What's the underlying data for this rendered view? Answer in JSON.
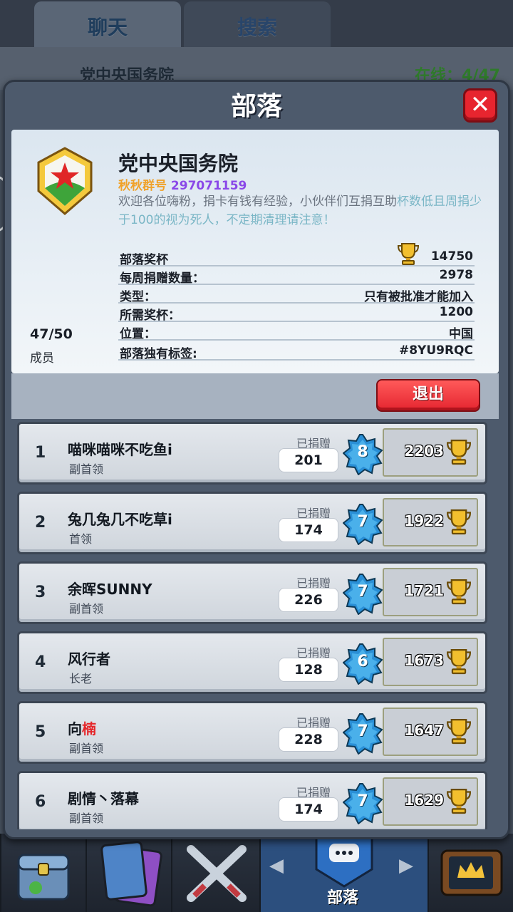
{
  "background": {
    "tabs": [
      {
        "label": "聊天"
      },
      {
        "label": "搜索"
      }
    ],
    "clan_name": "党中央国务院",
    "online": "在线：4/47",
    "bottom_nav_label": "部落"
  },
  "modal": {
    "title": "部落",
    "close": "✕"
  },
  "clan": {
    "name": "党中央国务院",
    "qq_label": "秋秋群号",
    "qq_number": "297071159",
    "desc_part1": "欢迎各位嗨粉，捐卡有钱有经验，小伙伴们互捐互助",
    "desc_part2": "杯数低且周捐少于",
    "desc_num": "100",
    "desc_part3": "的视为死人，不定期清理请注意！",
    "members_count": "47/50",
    "members_label": "成员",
    "stats": [
      {
        "label": "部落奖杯",
        "value": "14750"
      },
      {
        "label": "每周捐赠数量：",
        "value": "2978"
      },
      {
        "label": "类型：",
        "value": "只有被批准才能加入"
      },
      {
        "label": "所需奖杯：",
        "value": "1200"
      },
      {
        "label": "位置：",
        "value": "中国"
      },
      {
        "label": "部落独有标签:",
        "value": "#8YU9RQC"
      }
    ],
    "leave_button": "退出"
  },
  "members": [
    {
      "rank": "1",
      "name": "喵咪喵咪不吃鱼i",
      "name_red": "",
      "role": "副首领",
      "donated_label": "已捐赠",
      "donated": "201",
      "level": "8",
      "trophies": "2203"
    },
    {
      "rank": "2",
      "name": "兔几兔几不吃草i",
      "name_red": "",
      "role": "首领",
      "donated_label": "已捐赠",
      "donated": "174",
      "level": "7",
      "trophies": "1922"
    },
    {
      "rank": "3",
      "name": "余晖SUNNY",
      "name_red": "",
      "role": "副首领",
      "donated_label": "已捐赠",
      "donated": "226",
      "level": "7",
      "trophies": "1721"
    },
    {
      "rank": "4",
      "name": "风行者",
      "name_red": "",
      "role": "长老",
      "donated_label": "已捐赠",
      "donated": "128",
      "level": "6",
      "trophies": "1673"
    },
    {
      "rank": "5",
      "name": "向",
      "name_red": "楠",
      "role": "副首领",
      "donated_label": "已捐赠",
      "donated": "228",
      "level": "7",
      "trophies": "1647"
    },
    {
      "rank": "6",
      "name": "剧情丶落幕",
      "name_red": "",
      "role": "副首领",
      "donated_label": "已捐赠",
      "donated": "174",
      "level": "7",
      "trophies": "1629"
    }
  ]
}
